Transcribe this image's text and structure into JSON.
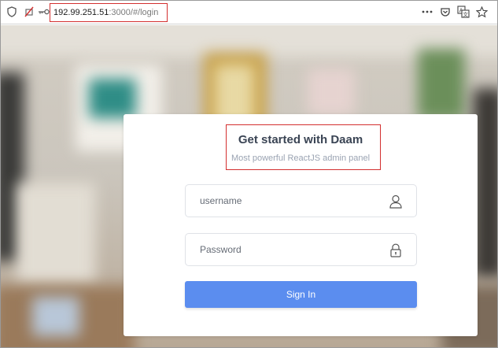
{
  "browser": {
    "url_host": "192.99.251.51",
    "url_path": ":3000/#/login",
    "icons": [
      "shield-icon",
      "blocked-permission-icon",
      "key-icon",
      "more-dots-icon",
      "pocket-icon",
      "translate-icon",
      "bookmark-star-icon"
    ]
  },
  "login": {
    "title": "Get started with Daam",
    "subtitle": "Most powerful ReactJS admin panel",
    "username_placeholder": "username",
    "password_placeholder": "Password",
    "signin_label": "Sign In"
  },
  "colors": {
    "accent": "#5b8def",
    "highlight": "#d32f2f"
  }
}
